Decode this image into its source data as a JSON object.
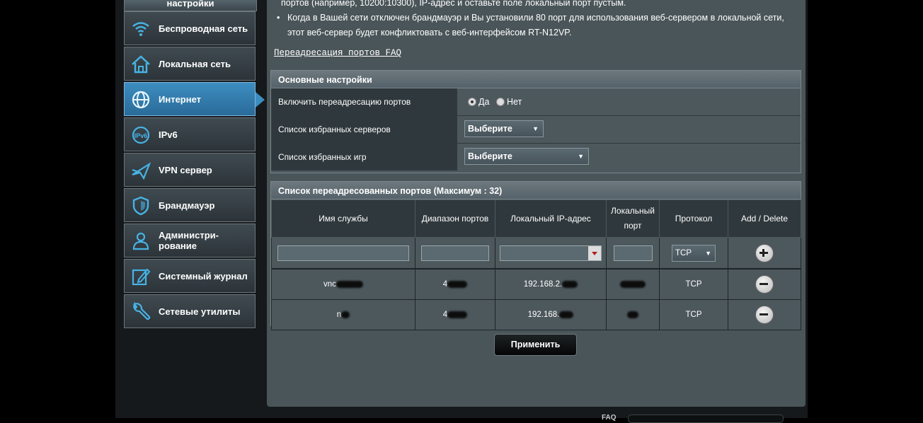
{
  "sidebar": {
    "top_label": "настройки",
    "items": [
      {
        "label": "Беспроводная сеть",
        "icon": "wifi-icon"
      },
      {
        "label": "Локальная сеть",
        "icon": "home-icon"
      },
      {
        "label": "Интернет",
        "icon": "globe-icon",
        "active": true
      },
      {
        "label": "IPv6",
        "icon": "ipv6-icon"
      },
      {
        "label": "VPN сервер",
        "icon": "vpn-icon"
      },
      {
        "label": "Брандмауэр",
        "icon": "shield-icon"
      },
      {
        "label": "Администри-рование",
        "icon": "admin-user-icon"
      },
      {
        "label": "Системный журнал",
        "icon": "log-edit-icon"
      },
      {
        "label": "Сетевые утилиты",
        "icon": "wrench-icon"
      }
    ]
  },
  "intro": {
    "line0": "портов (например, 10200:10300), IP-адрес и оставьте поле локальный порт пустым.",
    "bullet": "Когда в Вашей сети отключен брандмауэр и Вы установили 80 порт для использования веб-сервером в локальной сети, этот веб-сервер будет конфликтовать с веб-интерфейсом RT-N12VP.",
    "faq_link": "Переадресация портов FAQ"
  },
  "basic": {
    "title": "Основные настройки",
    "enable_label": "Включить переадресацию портов",
    "yes": "Да",
    "no": "Нет",
    "enabled": true,
    "servers_label": "Список избранных серверов",
    "servers_value": "Выберите",
    "games_label": "Список избранных игр",
    "games_value": "Выберите"
  },
  "ports": {
    "title": "Список переадресованных портов (Максимум : 32)",
    "headers": [
      "Имя службы",
      "Диапазон портов",
      "Локальный IP-адрес",
      "Локальный порт",
      "Протокол",
      "Add / Delete"
    ],
    "new_protocol": "TCP",
    "rows": [
      {
        "name": "vnc",
        "range": "4",
        "ip": "192.168.2.",
        "port": "",
        "protocol": "TCP"
      },
      {
        "name": "n",
        "range": "4",
        "ip": "192.168.",
        "port": "",
        "protocol": "TCP"
      }
    ]
  },
  "apply_label": "Применить",
  "footer_faq": "FAQ",
  "colors": {
    "accent": "#3d8dc0",
    "panel": "#4a5559",
    "sidebar": "#3a454b"
  }
}
